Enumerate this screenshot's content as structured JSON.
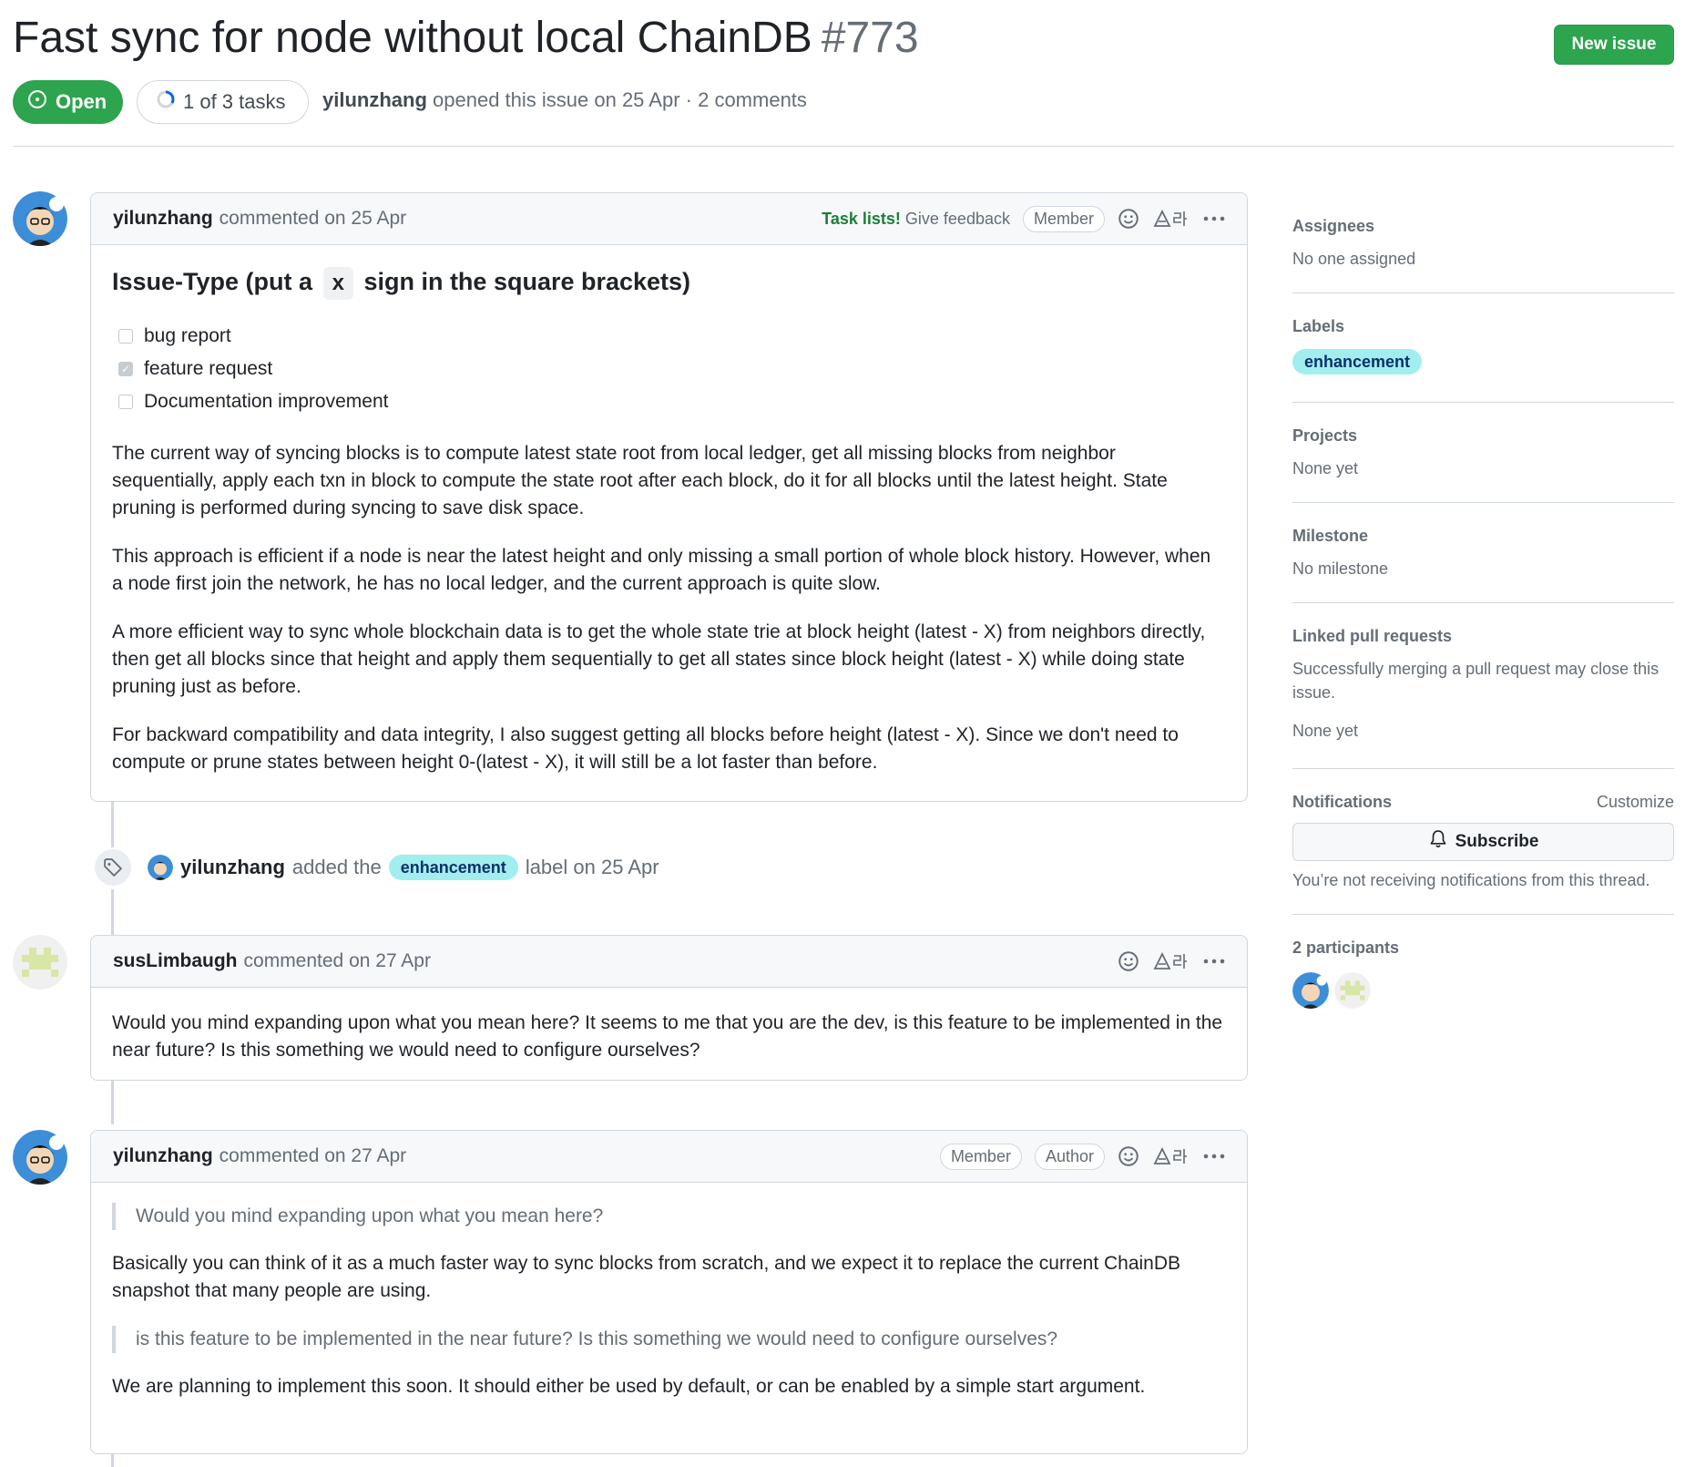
{
  "issue": {
    "title": "Fast sync for node without local ChainDB",
    "number": "#773",
    "state": "Open",
    "tasks": "1 of 3 tasks",
    "tasks_progress": 0.3333,
    "author": "yilunzhang",
    "meta_rest": "opened this issue on 25 Apr · 2 comments"
  },
  "header": {
    "new_issue_label": "New issue"
  },
  "comments": [
    {
      "author": "yilunzhang",
      "date_text": "commented on 25 Apr",
      "feedback_strong": "Task lists!",
      "feedback_rest": "Give feedback",
      "badges": [
        "Member"
      ],
      "heading_pre": "Issue-Type (put a",
      "heading_code": "x",
      "heading_post": "sign in the square brackets)",
      "tasks": [
        {
          "label": "bug report",
          "checked": false
        },
        {
          "label": "feature request",
          "checked": true
        },
        {
          "label": "Documentation improvement",
          "checked": false
        }
      ],
      "paragraphs": [
        "The current way of syncing blocks is to compute latest state root from local ledger, get all missing blocks from neighbor sequentially, apply each txn in block to compute the state root after each block, do it for all blocks until the latest height. State pruning is performed during syncing to save disk space.",
        "This approach is efficient if a node is near the latest height and only missing a small portion of whole block history. However, when a node first join the network, he has no local ledger, and the current approach is quite slow.",
        "A more efficient way to sync whole blockchain data is to get the whole state trie at block height (latest - X) from neighbors directly, then get all blocks since that height and apply them sequentially to get all states since block height (latest - X) while doing state pruning just as before.",
        "For backward compatibility and data integrity, I also suggest getting all blocks before height (latest - X). Since we don't need to compute or prune states between height 0-(latest - X), it will still be a lot faster than before."
      ]
    },
    {
      "author": "susLimbaugh",
      "date_text": "commented on 27 Apr",
      "paragraphs": [
        "Would you mind expanding upon what you mean here? It seems to me that you are the dev, is this feature to be implemented in the near future? Is this something we would need to configure ourselves?"
      ]
    },
    {
      "author": "yilunzhang",
      "date_text": "commented on 27 Apr",
      "badges": [
        "Member",
        "Author"
      ],
      "quote1": "Would you mind expanding upon what you mean here?",
      "para1": "Basically you can think of it as a much faster way to sync blocks from scratch, and we expect it to replace the current ChainDB snapshot that many people are using.",
      "quote2": "is this feature to be implemented in the near future? Is this something we would need to configure ourselves?",
      "para2": "We are planning to implement this soon. It should either be used by default, or can be enabled by a simple start argument."
    }
  ],
  "event": {
    "actor": "yilunzhang",
    "pre": "added the",
    "label": "enhancement",
    "post": "label on 25 Apr"
  },
  "sidebar": {
    "assignees_title": "Assignees",
    "assignees_value": "No one assigned",
    "labels_title": "Labels",
    "labels": [
      "enhancement"
    ],
    "projects_title": "Projects",
    "projects_value": "None yet",
    "milestone_title": "Milestone",
    "milestone_value": "No milestone",
    "linked_title": "Linked pull requests",
    "linked_desc": "Successfully merging a pull request may close this issue.",
    "linked_value": "None yet",
    "notifications_title": "Notifications",
    "customize": "Customize",
    "subscribe": "Subscribe",
    "notif_desc": "You’re not receiving notifications from this thread.",
    "participants_title": "2 participants"
  },
  "colors": {
    "open_green": "#2da44e",
    "label_bg": "#a2eeef",
    "link_green": "#1a7f37"
  }
}
